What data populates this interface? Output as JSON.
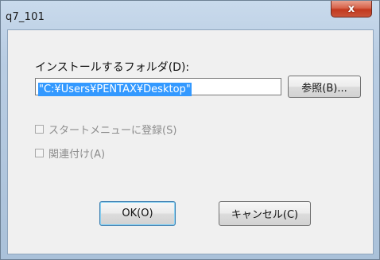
{
  "window": {
    "title": "q7_101",
    "close_label": "x"
  },
  "dialog": {
    "folder_label": "インストールするフォルダ(D):",
    "path_value": "\"C:¥Users¥PENTAX¥Desktop\"",
    "browse_label": "参照(B)...",
    "checkbox_start_menu": {
      "label": "スタートメニューに登録(S)",
      "checked": false,
      "enabled": false
    },
    "checkbox_association": {
      "label": "関連付け(A)",
      "checked": false,
      "enabled": false
    },
    "ok_label": "OK(O)",
    "cancel_label": "キャンセル(C)"
  },
  "colors": {
    "selection": "#3399ff",
    "close_button": "#c2391f",
    "frame": "#b9cde3"
  }
}
